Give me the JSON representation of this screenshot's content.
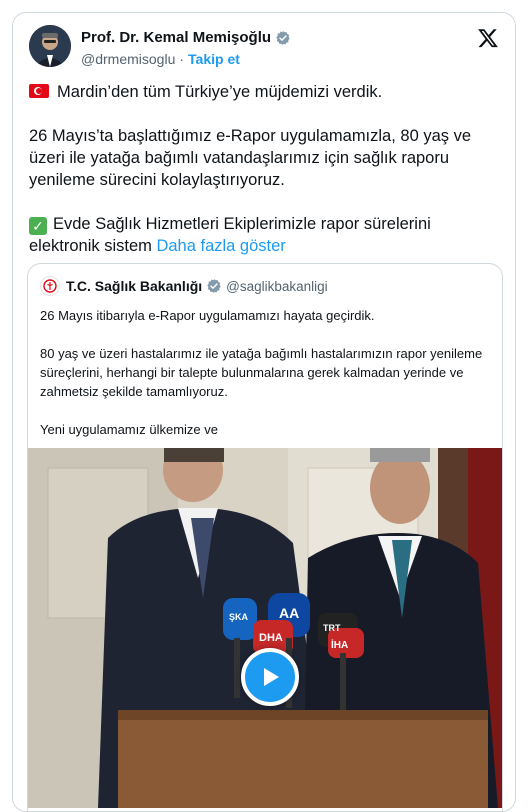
{
  "author": {
    "name": "Prof. Dr. Kemal Memişoğlu",
    "handle": "@drmemisoglu",
    "separator": "·",
    "follow_label": "Takip et"
  },
  "tweet": {
    "line1": "Mardin’den tüm Türkiye’ye müjdemizi verdik.",
    "paragraph2": "26 Mayıs’ta başlattığımız e-Rapor uygulamamızla, 80 yaş ve üzeri ile yatağa bağımlı vatandaşlarımız için sağlık raporu yenileme sürecini kolaylaştırıyoruz.",
    "paragraph3": "Evde Sağlık Hizmetleri Ekiplerimizle rapor sürelerini elektronik sistem",
    "show_more": "Daha fazla göster"
  },
  "quote": {
    "name": "T.C. Sağlık Bakanlığı",
    "handle": "@saglikbakanligi",
    "paragraph1": "26 Mayıs itibarıyla e-Rapor uygulamamızı hayata geçirdik.",
    "paragraph2": "80 yaş ve üzeri hastalarımız ile yatağa bağımlı hastalarımızın rapor yenileme süreçlerini, herhangi bir talepte bulunmalarına gerek kalmadan yerinde ve zahmetsiz şekilde tamamlıyoruz.",
    "paragraph3": "Yeni uygulamamız ülkemize ve"
  },
  "video": {
    "mic_labels": [
      "ŞKA",
      "AA",
      "DHA",
      "İHA",
      "TRT"
    ]
  },
  "colors": {
    "accent": "#1d9bf0",
    "text": "#0f1419",
    "muted": "#536471",
    "border": "#cfd9de"
  },
  "icons": [
    "verified-badge-icon",
    "x-logo-icon",
    "turkey-flag-icon",
    "check-mark-icon",
    "ministry-logo-icon",
    "play-icon"
  ]
}
